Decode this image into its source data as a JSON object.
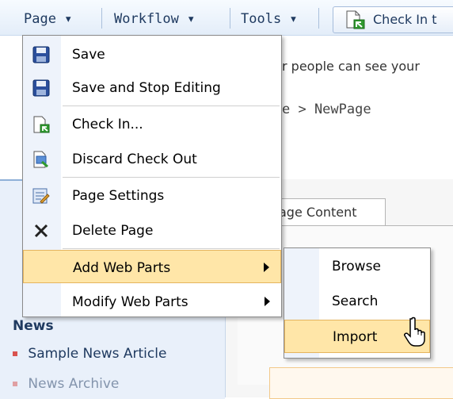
{
  "toolbar": {
    "page": "Page ▾",
    "workflow": "Workflow ▾",
    "tools": "Tools ▾",
    "check_in": "Check In t"
  },
  "background": {
    "notice": "r people can see your",
    "breadcrumb": "e > NewPage",
    "tab_label": "age Content",
    "news_heading": "News",
    "news_items": [
      "Sample News Article",
      "News Archive"
    ]
  },
  "menu": {
    "items": [
      {
        "label": "Save",
        "icon": "save-icon"
      },
      {
        "label": "Save and Stop Editing",
        "icon": "save-stop-icon"
      },
      {
        "label": "Check In...",
        "icon": "check-in-icon"
      },
      {
        "label": "Discard Check Out",
        "icon": "discard-checkout-icon"
      },
      {
        "label": "Page Settings",
        "icon": "page-settings-icon"
      },
      {
        "label": "Delete Page",
        "icon": "delete-icon"
      },
      {
        "label": "Add Web Parts",
        "icon": "",
        "submenu": true,
        "highlighted": true
      },
      {
        "label": "Modify Web Parts",
        "icon": "",
        "submenu": true
      }
    ]
  },
  "submenu": {
    "items": [
      {
        "label": "Browse"
      },
      {
        "label": "Search"
      },
      {
        "label": "Import",
        "highlighted": true
      }
    ]
  },
  "colors": {
    "highlight": "#ffe6a8",
    "highlight_border": "#e5b45e",
    "link": "#1f3a60",
    "bullet": "#d9534f"
  }
}
